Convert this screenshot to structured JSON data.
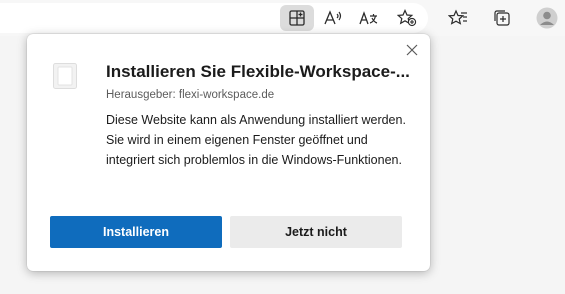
{
  "toolbar": {
    "icons": [
      "app-available-icon",
      "read-aloud-icon",
      "translate-icon",
      "add-favorite-icon",
      "favorites-icon",
      "collections-icon",
      "profile-avatar-icon"
    ]
  },
  "dialog": {
    "title": "Installieren Sie Flexible-Workspace-...",
    "publisher": "Herausgeber: flexi-workspace.de",
    "description": "Diese Website kann als Anwendung installiert werden. Sie wird in einem eigenen Fenster geöffnet und integriert sich problemlos in die Windows-Funktionen.",
    "install_label": "Installieren",
    "dismiss_label": "Jetzt nicht"
  },
  "colors": {
    "primary_button": "#0f6cbd",
    "secondary_button": "#ebebeb"
  }
}
